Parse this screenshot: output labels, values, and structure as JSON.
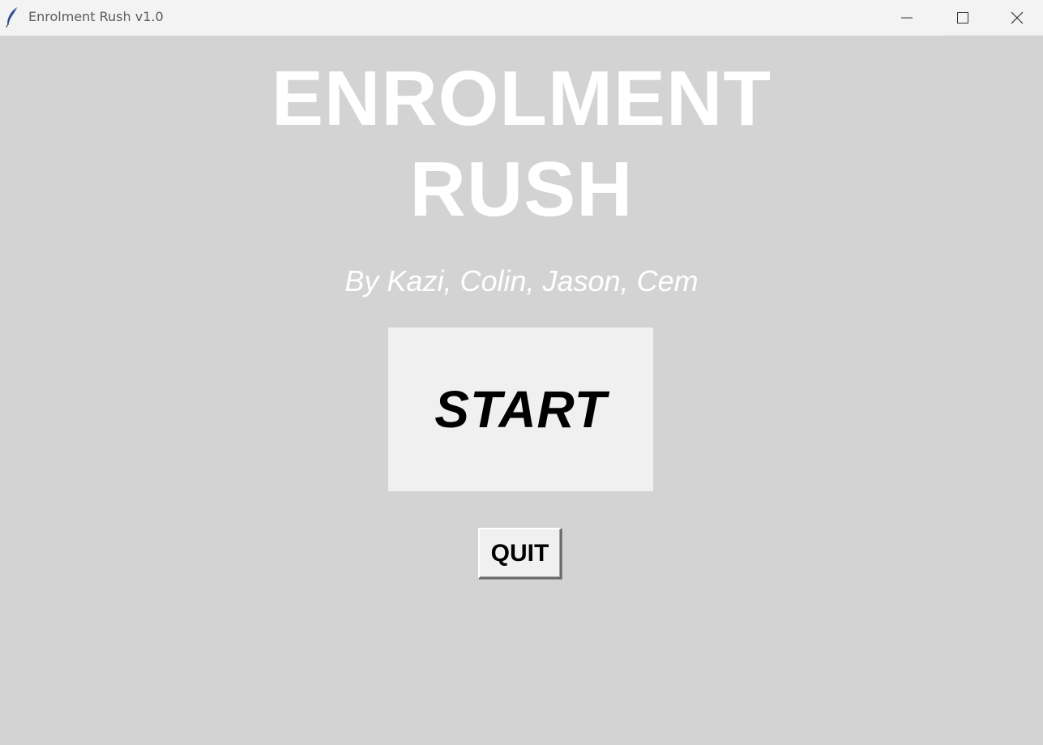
{
  "window": {
    "title": "Enrolment Rush v1.0",
    "icon": "feather-icon",
    "controls": {
      "minimize_icon": "minimize-icon",
      "maximize_icon": "maximize-icon",
      "close_icon": "close-icon"
    }
  },
  "menu": {
    "title_line1": "ENROLMENT",
    "title_line2": "RUSH",
    "credits": "By Kazi, Colin, Jason, Cem",
    "start_label": "START",
    "quit_label": "QUIT"
  },
  "colors": {
    "background": "#d3d3d3",
    "title_text": "#ffffff",
    "button_face": "#f0f0f0",
    "button_text": "#000000",
    "titlebar": "#f3f3f3"
  }
}
